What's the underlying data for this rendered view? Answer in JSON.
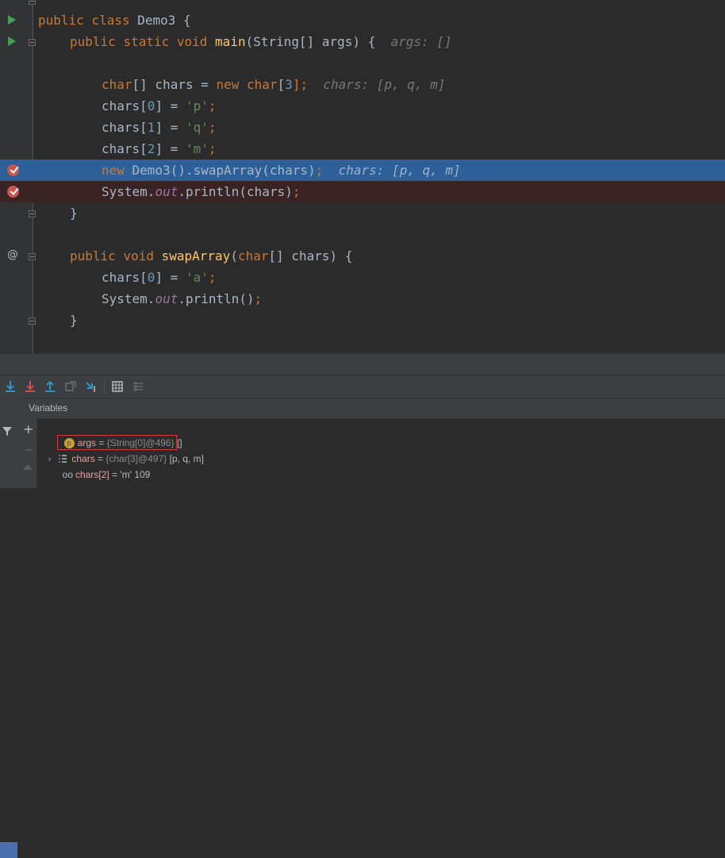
{
  "editor": {
    "lines": [
      {
        "id": "l1",
        "tokens": [
          {
            "t": "public ",
            "c": "kw"
          },
          {
            "t": "class ",
            "c": "kw"
          },
          {
            "t": "Demo3 {",
            "c": ""
          }
        ]
      },
      {
        "id": "l2",
        "tokens": [
          {
            "t": "public ",
            "c": "kw"
          },
          {
            "t": "static ",
            "c": "kw"
          },
          {
            "t": "void ",
            "c": "kw"
          },
          {
            "t": "main",
            "c": "fn"
          },
          {
            "t": "(String[] args) {  ",
            "c": ""
          },
          {
            "t": "args: []",
            "c": "hint"
          }
        ]
      },
      {
        "id": "l3",
        "tokens": []
      },
      {
        "id": "l4",
        "tokens": [
          {
            "t": "char",
            "c": "kw"
          },
          {
            "t": "[] chars = ",
            "c": ""
          },
          {
            "t": "new ",
            "c": "kw"
          },
          {
            "t": "char",
            "c": "kw"
          },
          {
            "t": "[",
            "c": ""
          },
          {
            "t": "3",
            "c": "num"
          },
          {
            "t": "];  ",
            "c": "kw"
          },
          {
            "t": "chars: [p, q, m]",
            "c": "hint"
          }
        ]
      },
      {
        "id": "l5",
        "tokens": [
          {
            "t": "chars[",
            "c": ""
          },
          {
            "t": "0",
            "c": "num"
          },
          {
            "t": "] = ",
            "c": ""
          },
          {
            "t": "'p'",
            "c": "str"
          },
          {
            "t": ";",
            "c": "kw"
          }
        ]
      },
      {
        "id": "l6",
        "tokens": [
          {
            "t": "chars[",
            "c": ""
          },
          {
            "t": "1",
            "c": "num"
          },
          {
            "t": "] = ",
            "c": ""
          },
          {
            "t": "'q'",
            "c": "str"
          },
          {
            "t": ";",
            "c": "kw"
          }
        ]
      },
      {
        "id": "l7",
        "tokens": [
          {
            "t": "chars[",
            "c": ""
          },
          {
            "t": "2",
            "c": "num"
          },
          {
            "t": "] = ",
            "c": ""
          },
          {
            "t": "'m'",
            "c": "str"
          },
          {
            "t": ";",
            "c": "kw"
          }
        ]
      },
      {
        "id": "l8",
        "tokens": [
          {
            "t": "new ",
            "c": "kw"
          },
          {
            "t": "Demo3().swapArray(chars)",
            "c": ""
          },
          {
            "t": ";  ",
            "c": "kw"
          },
          {
            "t": "chars: [p, q, m]",
            "c": "hint"
          }
        ]
      },
      {
        "id": "l9",
        "tokens": [
          {
            "t": "System.",
            "c": ""
          },
          {
            "t": "out",
            "c": "fld"
          },
          {
            "t": ".println(chars)",
            "c": ""
          },
          {
            "t": ";",
            "c": "kw"
          }
        ]
      },
      {
        "id": "l10",
        "tokens": [
          {
            "t": "}",
            "c": ""
          }
        ]
      },
      {
        "id": "l11",
        "tokens": []
      },
      {
        "id": "l12",
        "tokens": [
          {
            "t": "public ",
            "c": "kw"
          },
          {
            "t": "void ",
            "c": "kw"
          },
          {
            "t": "swapArray",
            "c": "fn"
          },
          {
            "t": "(",
            "c": ""
          },
          {
            "t": "char",
            "c": "kw"
          },
          {
            "t": "[] chars) {",
            "c": ""
          }
        ]
      },
      {
        "id": "l13",
        "tokens": [
          {
            "t": "chars[",
            "c": ""
          },
          {
            "t": "0",
            "c": "num"
          },
          {
            "t": "] = ",
            "c": ""
          },
          {
            "t": "'a'",
            "c": "str"
          },
          {
            "t": ";",
            "c": "kw"
          }
        ]
      },
      {
        "id": "l14",
        "tokens": [
          {
            "t": "System.",
            "c": ""
          },
          {
            "t": "out",
            "c": "fld"
          },
          {
            "t": ".println()",
            "c": ""
          },
          {
            "t": ";",
            "c": "kw"
          }
        ]
      },
      {
        "id": "l15",
        "tokens": [
          {
            "t": "}",
            "c": ""
          }
        ]
      }
    ]
  },
  "variables": {
    "header": "Variables",
    "rows": [
      {
        "name": "args",
        "eq": " = ",
        "type": "{String[0]@496}",
        "value": " []"
      },
      {
        "name": "chars",
        "eq": " = ",
        "type": "{char[3]@497}",
        "value": " [p, q, m]"
      },
      {
        "name": "chars[2]",
        "eq": " = ",
        "type": "",
        "value": "'m' 109"
      }
    ]
  },
  "icons": {
    "toolbar": [
      "step-over-icon",
      "step-into-icon",
      "force-step-into-icon",
      "step-out-icon",
      "drop-frame-icon",
      "run-to-cursor-icon",
      "evaluate-expression-icon",
      "trace-icon"
    ]
  }
}
